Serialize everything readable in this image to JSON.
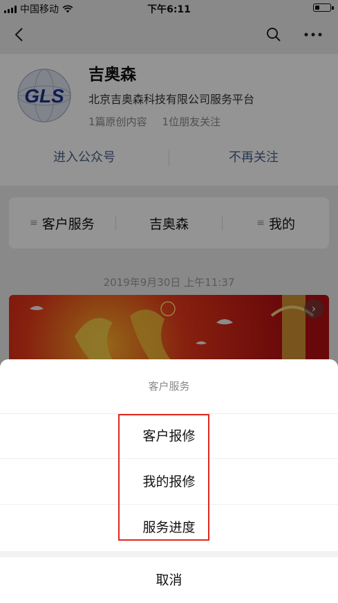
{
  "status_bar": {
    "carrier": "中国移动",
    "time": "下午6:11"
  },
  "nav": {
    "back_icon": "chevron-left-icon",
    "search_icon": "search-icon",
    "more_icon": "more-icon"
  },
  "account": {
    "logo_text": "GLS",
    "name": "吉奥森",
    "description": "北京吉奥森科技有限公司服务平台",
    "stats": {
      "original": "1篇原创内容",
      "friends": "1位朋友关注"
    },
    "actions": {
      "enter": "进入公众号",
      "unfollow": "不再关注"
    }
  },
  "menu": {
    "items": [
      {
        "label": "客户服务"
      },
      {
        "label": "吉奥森"
      },
      {
        "label": "我的"
      }
    ]
  },
  "message": {
    "timestamp": "2019年9月30日 上午11:37"
  },
  "action_sheet": {
    "title": "客户服务",
    "options": [
      {
        "label": "客户报修"
      },
      {
        "label": "我的报修"
      },
      {
        "label": "服务进度"
      }
    ],
    "cancel": "取消"
  },
  "colors": {
    "accent_link": "#4a6289",
    "highlight": "#e1261c"
  }
}
